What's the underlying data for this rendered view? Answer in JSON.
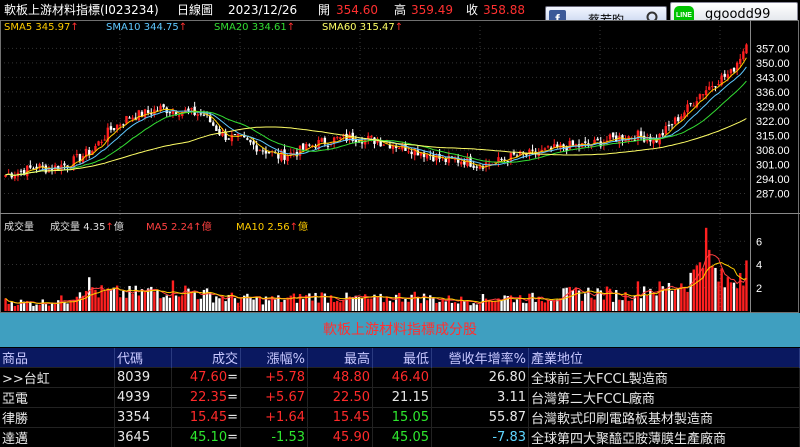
{
  "header": {
    "title": "軟板上游材料指標(I023234)",
    "period": "日線圖",
    "date": "2023/12/26",
    "open_label": "開",
    "open": "354.60",
    "high_label": "高",
    "high": "359.49",
    "close_label": "收",
    "close": "358.88"
  },
  "social": {
    "facebook_name": "蔡若昀",
    "line_id": "ggoodd99",
    "fb_icon": "facebook-icon",
    "search_icon": "search-icon",
    "line_icon": "line-icon"
  },
  "price_legend": [
    {
      "label": "SMA5",
      "value": "345.97",
      "arrow": "↑",
      "color": "#ffcc00"
    },
    {
      "label": "SMA10",
      "value": "344.75",
      "arrow": "↑",
      "color": "#5fc8ff"
    },
    {
      "label": "SMA20",
      "value": "334.61",
      "arrow": "↑",
      "color": "#33dd33"
    },
    {
      "label": "SMA60",
      "value": "315.47",
      "arrow": "↑",
      "color": "#ffff66"
    }
  ],
  "volume_legend": {
    "label": "成交量",
    "value_label": "成交量",
    "value": "4.35",
    "arrow": "↑",
    "unit": "億",
    "ma5_label": "MA5",
    "ma5": "2.24",
    "ma10_label": "MA10",
    "ma10": "2.56"
  },
  "chart_data": [
    {
      "type": "candlestick",
      "ylim": [
        280,
        362
      ],
      "yticks": [
        "357.00",
        "350.00",
        "343.00",
        "336.00",
        "329.00",
        "322.00",
        "315.00",
        "308.00",
        "301.00",
        "294.00",
        "287.00"
      ],
      "ytick_values": [
        357,
        350,
        343,
        336,
        329,
        322,
        315,
        308,
        301,
        294,
        287
      ],
      "last": {
        "open": 354.6,
        "high": 359.49,
        "close": 358.88
      },
      "series": [
        {
          "name": "SMA5",
          "color": "#ffcc00",
          "last": 345.97
        },
        {
          "name": "SMA10",
          "color": "#5fc8ff",
          "last": 344.75
        },
        {
          "name": "SMA20",
          "color": "#33dd33",
          "last": 334.61
        },
        {
          "name": "SMA60",
          "color": "#ffff66",
          "last": 315.47
        }
      ],
      "close_anchors": [
        [
          0,
          296
        ],
        [
          6,
          298
        ],
        [
          10,
          300
        ],
        [
          14,
          299
        ],
        [
          20,
          301
        ],
        [
          28,
          308
        ],
        [
          34,
          318
        ],
        [
          40,
          324
        ],
        [
          46,
          326
        ],
        [
          50,
          328
        ],
        [
          56,
          327
        ],
        [
          60,
          326
        ],
        [
          64,
          325
        ],
        [
          70,
          315
        ],
        [
          76,
          313
        ],
        [
          82,
          309
        ],
        [
          88,
          305
        ],
        [
          94,
          307
        ],
        [
          100,
          311
        ],
        [
          106,
          313
        ],
        [
          112,
          314
        ],
        [
          118,
          313
        ],
        [
          124,
          311
        ],
        [
          130,
          309
        ],
        [
          136,
          306
        ],
        [
          142,
          303
        ],
        [
          148,
          303
        ],
        [
          152,
          301
        ],
        [
          158,
          302
        ],
        [
          164,
          305
        ],
        [
          170,
          306
        ],
        [
          176,
          308
        ],
        [
          182,
          310
        ],
        [
          188,
          310
        ],
        [
          192,
          312
        ],
        [
          198,
          314
        ],
        [
          204,
          315
        ],
        [
          210,
          313
        ],
        [
          214,
          319
        ],
        [
          220,
          328
        ],
        [
          224,
          335
        ],
        [
          230,
          342
        ],
        [
          234,
          345
        ],
        [
          239,
          358.88
        ]
      ]
    },
    {
      "type": "bar",
      "title": "成交量",
      "ylim": [
        0,
        8
      ],
      "yticks": [
        "6",
        "4",
        "2"
      ],
      "ytick_values": [
        6,
        4,
        2
      ],
      "last": {
        "volume": 4.35,
        "ma5": 2.24,
        "ma10": 2.56
      },
      "series": [
        {
          "name": "MA5",
          "color": "#ff4040"
        },
        {
          "name": "MA10",
          "color": "#ffcc00"
        }
      ],
      "volume_anchors": [
        [
          0,
          0.8
        ],
        [
          10,
          0.7
        ],
        [
          20,
          1.0
        ],
        [
          26,
          2.4
        ],
        [
          30,
          1.6
        ],
        [
          40,
          1.5
        ],
        [
          48,
          1.7
        ],
        [
          55,
          2.0
        ],
        [
          60,
          1.6
        ],
        [
          70,
          1.2
        ],
        [
          80,
          1.0
        ],
        [
          90,
          1.0
        ],
        [
          100,
          1.3
        ],
        [
          110,
          1.1
        ],
        [
          120,
          1.0
        ],
        [
          130,
          1.3
        ],
        [
          140,
          1.0
        ],
        [
          150,
          0.9
        ],
        [
          160,
          1.2
        ],
        [
          170,
          1.1
        ],
        [
          180,
          1.4
        ],
        [
          190,
          1.6
        ],
        [
          200,
          1.3
        ],
        [
          205,
          2.0
        ],
        [
          212,
          1.8
        ],
        [
          218,
          2.4
        ],
        [
          222,
          3.0
        ],
        [
          225,
          6.5
        ],
        [
          228,
          3.5
        ],
        [
          232,
          2.3
        ],
        [
          236,
          3.0
        ],
        [
          239,
          4.35
        ]
      ]
    },
    {
      "type": "table",
      "title": "軟板上游材料指標成分股",
      "columns": [
        "商品",
        "代碼",
        "成交",
        "漲幅%",
        "最高",
        "最低",
        "營收年增率%",
        "產業地位"
      ],
      "rows": [
        [
          ">>台虹",
          "8039",
          "47.60",
          "+5.78",
          "48.80",
          "46.40",
          "26.80",
          "全球前三大FCCL製造商"
        ],
        [
          "亞電",
          "4939",
          "22.35",
          "+5.67",
          "22.50",
          "21.15",
          "3.11",
          "台灣第二大FCCL廠商"
        ],
        [
          "律勝",
          "3354",
          "15.45",
          "+1.64",
          "15.45",
          "15.05",
          "55.87",
          "台灣軟式印刷電路板基材製造商"
        ],
        [
          "達邁",
          "3645",
          "45.10",
          "-1.53",
          "45.90",
          "45.05",
          "-7.83",
          "全球第四大聚醯亞胺薄膜生產廠商"
        ]
      ],
      "row_colors": [
        [
          "wh",
          "wh",
          "rd",
          "rd",
          "rd",
          "rd",
          "wh",
          "wh"
        ],
        [
          "wh",
          "wh",
          "rd",
          "rd",
          "rd",
          "wh",
          "wh",
          "wh"
        ],
        [
          "wh",
          "wh",
          "rd",
          "rd",
          "rd",
          "gn",
          "wh",
          "wh"
        ],
        [
          "wh",
          "wh",
          "gn",
          "gn",
          "rd",
          "gn",
          "cy",
          "wh"
        ]
      ],
      "row_suffix": [
        "=",
        "=",
        "=",
        "="
      ]
    }
  ]
}
